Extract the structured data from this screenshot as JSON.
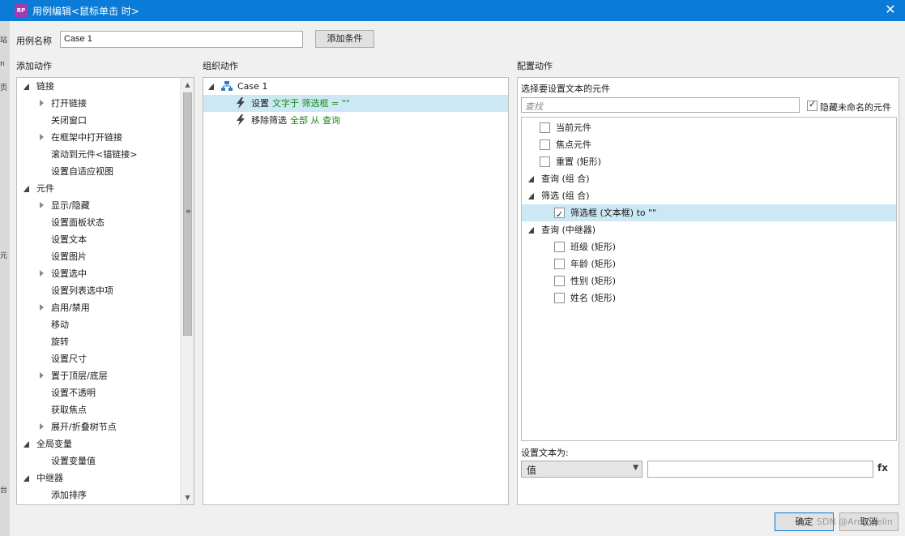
{
  "window": {
    "app_icon_text": "RP",
    "title": "用例编辑<鼠标单击 时>",
    "close_glyph": "✕"
  },
  "background_fragments": [
    "站",
    "n",
    "页",
    "元",
    "台"
  ],
  "case": {
    "label": "用例名称",
    "value": "Case 1",
    "add_condition": "添加条件"
  },
  "sections": {
    "add_action": "添加动作",
    "organize_action": "组织动作",
    "configure_action": "配置动作"
  },
  "add_action_tree": [
    {
      "label": "链接",
      "level": 0,
      "state": "open"
    },
    {
      "label": "打开链接",
      "level": 1,
      "state": "closed"
    },
    {
      "label": "关闭窗口",
      "level": 1,
      "state": "leaf"
    },
    {
      "label": "在框架中打开链接",
      "level": 1,
      "state": "closed"
    },
    {
      "label": "滚动到元件<锚链接>",
      "level": 1,
      "state": "leaf"
    },
    {
      "label": "设置自适应视图",
      "level": 1,
      "state": "leaf"
    },
    {
      "label": "元件",
      "level": 0,
      "state": "open"
    },
    {
      "label": "显示/隐藏",
      "level": 1,
      "state": "closed"
    },
    {
      "label": "设置面板状态",
      "level": 1,
      "state": "leaf"
    },
    {
      "label": "设置文本",
      "level": 1,
      "state": "leaf"
    },
    {
      "label": "设置图片",
      "level": 1,
      "state": "leaf"
    },
    {
      "label": "设置选中",
      "level": 1,
      "state": "closed"
    },
    {
      "label": "设置列表选中项",
      "level": 1,
      "state": "leaf"
    },
    {
      "label": "启用/禁用",
      "level": 1,
      "state": "closed"
    },
    {
      "label": "移动",
      "level": 1,
      "state": "leaf"
    },
    {
      "label": "旋转",
      "level": 1,
      "state": "leaf"
    },
    {
      "label": "设置尺寸",
      "level": 1,
      "state": "leaf"
    },
    {
      "label": "置于顶层/底层",
      "level": 1,
      "state": "closed"
    },
    {
      "label": "设置不透明",
      "level": 1,
      "state": "leaf"
    },
    {
      "label": "获取焦点",
      "level": 1,
      "state": "leaf"
    },
    {
      "label": "展开/折叠树节点",
      "level": 1,
      "state": "closed"
    },
    {
      "label": "全局变量",
      "level": 0,
      "state": "open"
    },
    {
      "label": "设置变量值",
      "level": 1,
      "state": "leaf"
    },
    {
      "label": "中继器",
      "level": 0,
      "state": "open"
    },
    {
      "label": "添加排序",
      "level": 1,
      "state": "leaf"
    }
  ],
  "organize": {
    "case_name": "Case 1",
    "actions": [
      {
        "verb": "设置",
        "detail": "文字于 筛选框 = \"\""
      },
      {
        "verb": "移除筛选",
        "detail": "全部 从 查询"
      }
    ]
  },
  "configure": {
    "select_label": "选择要设置文本的元件",
    "search_placeholder": "查找",
    "hide_unnamed": "隐藏未命名的元件",
    "hide_unnamed_checked": true,
    "tree": [
      {
        "label": "当前元件",
        "type": "check",
        "level": 1,
        "checked": false
      },
      {
        "label": "焦点元件",
        "type": "check",
        "level": 1,
        "checked": false
      },
      {
        "label": "重置 (矩形)",
        "type": "check",
        "level": 1,
        "checked": false
      },
      {
        "label": "查询 (组 合)",
        "type": "group",
        "level": 0
      },
      {
        "label": "筛选 (组 合)",
        "type": "group",
        "level": 0
      },
      {
        "label": "筛选框 (文本框) to \"\"",
        "type": "check",
        "level": 2,
        "checked": true,
        "selected": true
      },
      {
        "label": "查询 (中继器)",
        "type": "group",
        "level": 0
      },
      {
        "label": "班级 (矩形)",
        "type": "check",
        "level": 2,
        "checked": false
      },
      {
        "label": "年龄 (矩形)",
        "type": "check",
        "level": 2,
        "checked": false
      },
      {
        "label": "性别 (矩形)",
        "type": "check",
        "level": 2,
        "checked": false
      },
      {
        "label": "姓名 (矩形)",
        "type": "check",
        "level": 2,
        "checked": false
      }
    ],
    "set_text_label": "设置文本为:",
    "set_text_type": "值",
    "set_text_value": "",
    "fx_label": "fx"
  },
  "buttons": {
    "ok": "确定",
    "cancel": "取消"
  },
  "watermark": "SDN @ArnoWelin"
}
